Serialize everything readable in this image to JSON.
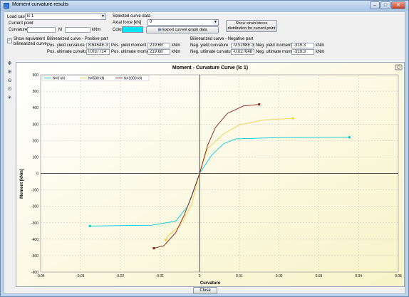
{
  "window": {
    "title": "Moment curvature results"
  },
  "form": {
    "load_case_label": "Load case",
    "load_case_value": "lc 1",
    "current_point_label": "Current point",
    "curvature_label": "Curvature",
    "m_label": "M",
    "knm_unit": "kNm",
    "selected_curve_label": "Selected curve data",
    "axial_force_label": "Axial force [kN]",
    "axial_force_value": "0",
    "color_label": "Color",
    "color_value": "#00e5ff",
    "export_button": "Export current graph data",
    "strain_button_line1": "Show strain/stress",
    "strain_button_line2": "distribution for current point",
    "show_bilinear_label_line1": "Show equivalent",
    "show_bilinear_label_line2": "bilinearized curve",
    "show_bilinear_checked": true
  },
  "positive": {
    "header": "Bilinearized curve - Positive part",
    "yield_curv_label": "Pos. yield curvature",
    "yield_curv_value": "8.6454E-3",
    "ult_curv_label": "Pos. ultimate curvature",
    "ult_curv_value": "0.037714",
    "yield_moment_label": "Pos. yield moment",
    "yield_moment_value": "219.68",
    "ult_moment_label": "Pos. ultimate moment",
    "ult_moment_value": "219.68",
    "unit": "kNm"
  },
  "negative": {
    "header": "Bilinearized curve - Negative part",
    "yield_curv_label": "Neg. yield curvature",
    "yield_curv_value": "-9.5298E-3",
    "ult_curv_label": "Neg. ultimate curvature",
    "ult_curv_value": "-0.027648",
    "yield_moment_label": "Neg. yield moment",
    "yield_moment_value": "-319.3",
    "ult_moment_label": "Neg. ultimate moment",
    "ult_moment_value": "-319.3",
    "unit": "kNm"
  },
  "toolbar": {
    "icons": [
      "pan-icon",
      "zoom-in-icon",
      "zoom-out-icon",
      "zoom-fit-icon",
      "reset-icon"
    ]
  },
  "close_button": "Close",
  "colors": {
    "n0": "#00c8dc",
    "n500": "#f0d048",
    "n1000": "#8b1a1a",
    "plot_bg": "#fbf8dc"
  },
  "chart_data": {
    "type": "line",
    "title": "Moment - Curvature Curve (lc 1)",
    "xlabel": "Curvature",
    "ylabel": "Moment [kNm]",
    "xlim": [
      -0.04,
      0.05
    ],
    "ylim": [
      -600,
      600
    ],
    "xticks": [
      "-0.04",
      "-0.03",
      "-0.02",
      "-0.01",
      "0",
      "0.01",
      "0.02",
      "0.03",
      "0.04",
      "0.05"
    ],
    "yticks": [
      "-600",
      "-500",
      "-400",
      "-300",
      "-200",
      "-100",
      "0",
      "100",
      "200",
      "300",
      "400",
      "500",
      "600"
    ],
    "grid": true,
    "legend_position": "top-left",
    "series": [
      {
        "name": "N=0 kN",
        "color": "#00c8dc",
        "x": [
          -0.0276,
          -0.012,
          -0.006,
          -0.003,
          0,
          0.003,
          0.006,
          0.009,
          0.02,
          0.0377
        ],
        "y": [
          -320,
          -315,
          -290,
          -200,
          0,
          110,
          180,
          210,
          218,
          220
        ]
      },
      {
        "name": "N=500 kN",
        "color": "#f0d048",
        "x": [
          -0.0085,
          -0.008,
          -0.005,
          -0.002,
          0,
          0.002,
          0.006,
          0.01,
          0.016,
          0.0235
        ],
        "y": [
          -405,
          -380,
          -320,
          -190,
          0,
          150,
          240,
          295,
          325,
          335
        ]
      },
      {
        "name": "N=1000 kN",
        "color": "#8b1a1a",
        "x": [
          -0.0115,
          -0.009,
          -0.006,
          -0.004,
          -0.002,
          0,
          0.002,
          0.004,
          0.007,
          0.011,
          0.015
        ],
        "y": [
          -455,
          -440,
          -360,
          -260,
          -140,
          0,
          170,
          280,
          365,
          410,
          420
        ]
      }
    ]
  }
}
